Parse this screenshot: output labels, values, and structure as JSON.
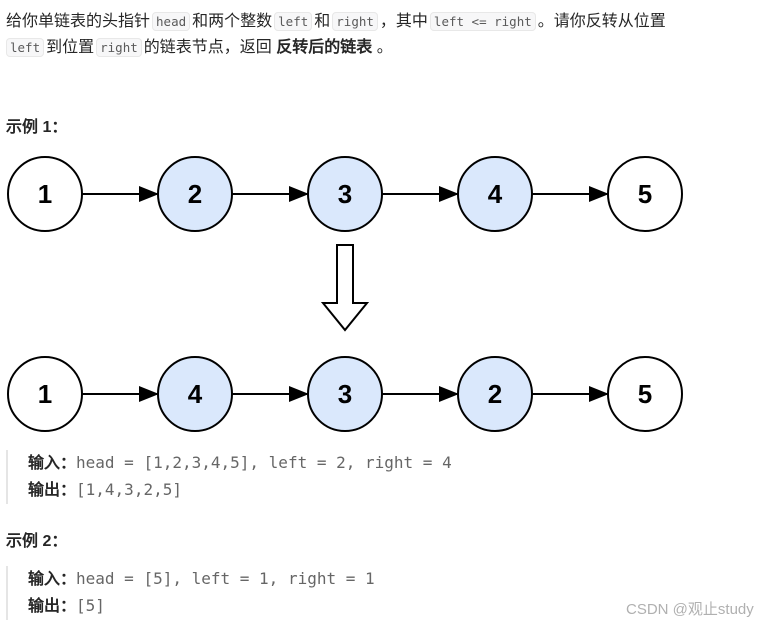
{
  "description": {
    "t1": "给你单链表的头指针",
    "c_head": "head",
    "t2": "和两个整数",
    "c_left": "left",
    "t3": "和",
    "c_right": "right",
    "t4": "，其中",
    "c_cond": "left <= right",
    "t5": "。请你反转从位置",
    "c_left2": "left",
    "t6": "到位置",
    "c_right2": "right",
    "t7": "的链表节点，返回",
    "bold": "反转后的链表",
    "t8": "。"
  },
  "example1": {
    "title": "示例 1：",
    "before": [
      "1",
      "2",
      "3",
      "4",
      "5"
    ],
    "after": [
      "1",
      "4",
      "3",
      "2",
      "5"
    ],
    "highlight_fill": "#dae8fc",
    "input_label": "输入：",
    "input": "head = [1,2,3,4,5], left = 2, right = 4",
    "output_label": "输出：",
    "output": "[1,4,3,2,5]"
  },
  "example2": {
    "title": "示例 2：",
    "input_label": "输入：",
    "input": "head = [5], left = 1, right = 1",
    "output_label": "输出：",
    "output": "[5]"
  },
  "watermark": "CSDN @观止study"
}
